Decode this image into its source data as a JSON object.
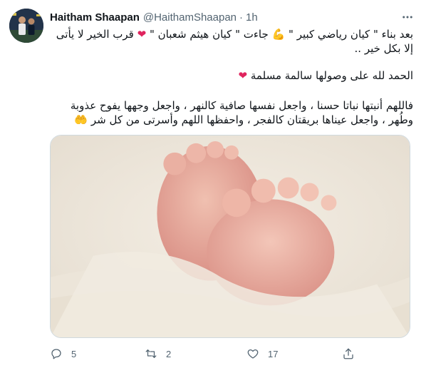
{
  "tweet": {
    "display_name": "Haitham Shaapan",
    "handle": "@HaithamShaapan",
    "separator": "·",
    "time": "1h",
    "paragraph1": {
      "part1": "بعد بناء \" كيان رياضي كبير \"",
      "part2": "جاءت \" كيان هيثم شعبان \"",
      "part3": "قرب الخير لا يأتى إلا بكل خير .."
    },
    "paragraph2": "الحمد لله على وصولها سالمة مسلمة",
    "paragraph3": "فاللهم أنبتها نباتا حسنا ، واجعل نفسها صافية كالنهر ، واجعل وجهها يفوح عذوبة وطُهر ، واجعل عيناها بريقتان كالفجر ، واحفظها اللهم وأسرتى من كل شر",
    "emojis": {
      "muscle": "💪",
      "heart": "❤",
      "hands": "🤲"
    },
    "media": {
      "description_icon": "baby-feet-photo"
    }
  },
  "actions": {
    "reply_count": "5",
    "retweet_count": "2",
    "like_count": "17"
  },
  "icons": {
    "more": "more-icon",
    "reply": "reply-icon",
    "retweet": "retweet-icon",
    "like": "like-icon",
    "share": "share-icon"
  },
  "colors": {
    "text": "#0f1419",
    "secondary": "#536471",
    "heart": "#e0245e",
    "border": "#cfd9de"
  }
}
